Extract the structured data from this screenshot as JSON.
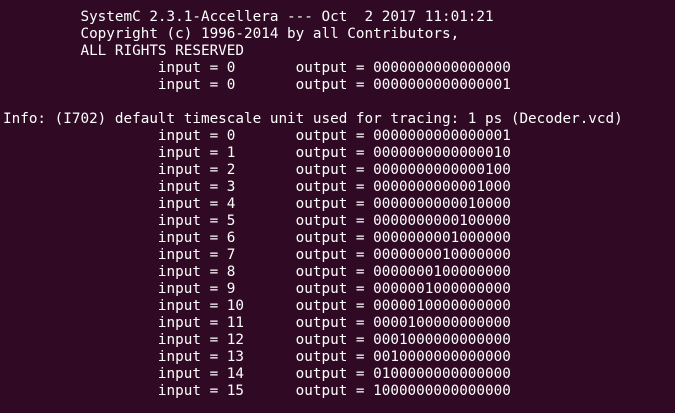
{
  "terminal": {
    "background_color": "#300a24",
    "text_color": "#ffffff",
    "lines": [
      "         SystemC 2.3.1-Accellera --- Oct  2 2017 11:01:21",
      "         Copyright (c) 1996-2014 by all Contributors,",
      "         ALL RIGHTS RESERVED",
      "                  input = 0       output = 0000000000000000",
      "                  input = 0       output = 0000000000000001",
      "",
      "Info: (I702) default timescale unit used for tracing: 1 ps (Decoder.vcd)",
      "                  input = 0       output = 0000000000000001",
      "                  input = 1       output = 0000000000000010",
      "                  input = 2       output = 0000000000000100",
      "                  input = 3       output = 0000000000001000",
      "                  input = 4       output = 0000000000010000",
      "                  input = 5       output = 0000000000100000",
      "                  input = 6       output = 0000000001000000",
      "                  input = 7       output = 0000000010000000",
      "                  input = 8       output = 0000000100000000",
      "                  input = 9       output = 0000001000000000",
      "                  input = 10      output = 0000010000000000",
      "                  input = 11      output = 0000100000000000",
      "                  input = 12      output = 0001000000000000",
      "                  input = 13      output = 0010000000000000",
      "                  input = 14      output = 0100000000000000",
      "                  input = 15      output = 1000000000000000"
    ]
  }
}
